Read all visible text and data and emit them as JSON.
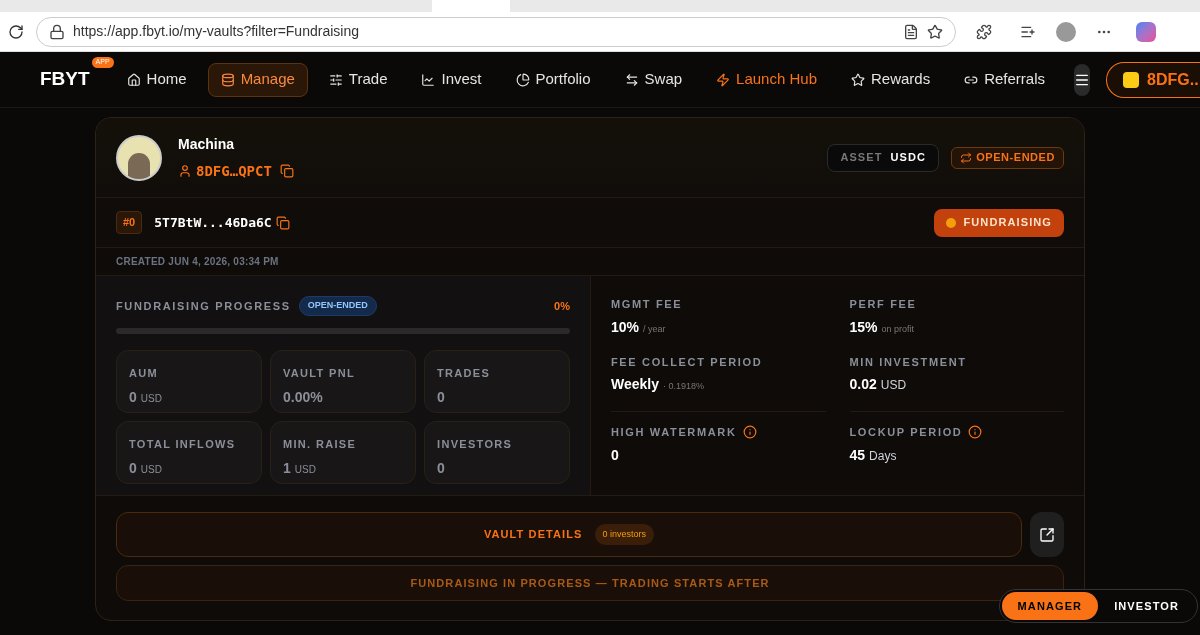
{
  "browser": {
    "url": "https://app.fbyt.io/my-vaults?filter=Fundraising"
  },
  "nav": {
    "logo": "FBYT",
    "logo_badge": "APP",
    "items": [
      {
        "label": "Home",
        "selected": false,
        "highlight": false
      },
      {
        "label": "Manage",
        "selected": true,
        "highlight": false
      },
      {
        "label": "Trade",
        "selected": false,
        "highlight": false
      },
      {
        "label": "Invest",
        "selected": false,
        "highlight": false
      },
      {
        "label": "Portfolio",
        "selected": false,
        "highlight": false
      },
      {
        "label": "Swap",
        "selected": false,
        "highlight": false
      },
      {
        "label": "Launch Hub",
        "selected": false,
        "highlight": true
      },
      {
        "label": "Rewards",
        "selected": false,
        "highlight": false
      },
      {
        "label": "Referrals",
        "selected": false,
        "highlight": false
      }
    ],
    "wallet": "8DFG.."
  },
  "vault": {
    "owner": "Machina",
    "owner_address": "8DFG…QPCT",
    "asset_label": "ASSET",
    "asset": "USDC",
    "type_badge": "OPEN-ENDED",
    "index": "#0",
    "address": "5T7BtW...46Da6C",
    "status": "FUNDRAISING",
    "created": "CREATED JUN 4, 2026, 03:34 PM",
    "progress": {
      "label": "FUNDRAISING PROGRESS",
      "badge": "OPEN-ENDED",
      "percent": "0%",
      "level": 0
    },
    "stats": [
      {
        "label": "AUM",
        "value": "0",
        "unit": "USD"
      },
      {
        "label": "VAULT PNL",
        "value": "0.00%"
      },
      {
        "label": "TRADES",
        "value": "0"
      },
      {
        "label": "TOTAL INFLOWS",
        "value": "0",
        "unit": "USD"
      },
      {
        "label": "MIN. RAISE",
        "value": "1",
        "unit": "USD"
      },
      {
        "label": "INVESTORS",
        "value": "0"
      }
    ],
    "fees": [
      {
        "label": "MGMT FEE",
        "value": "10%",
        "note": "/ year",
        "info": false
      },
      {
        "label": "PERF FEE",
        "value": "15%",
        "note": "on profit",
        "info": false
      },
      {
        "label": "FEE COLLECT PERIOD",
        "value": "Weekly",
        "note": "· 0.1918%",
        "info": false
      },
      {
        "label": "MIN INVESTMENT",
        "value": "0.02",
        "unit": "USD",
        "info": false
      },
      {
        "label": "HIGH WATERMARK",
        "value": "0",
        "info": true
      },
      {
        "label": "LOCKUP PERIOD",
        "value": "45",
        "unit": "Days",
        "info": true
      }
    ],
    "details_button": "VAULT DETAILS",
    "details_badge": "0 investors",
    "notice": "FUNDRAISING IN PROGRESS — TRADING STARTS AFTER"
  },
  "role_toggle": [
    {
      "label": "MANAGER",
      "selected": true
    },
    {
      "label": "INVESTOR",
      "selected": false
    }
  ]
}
